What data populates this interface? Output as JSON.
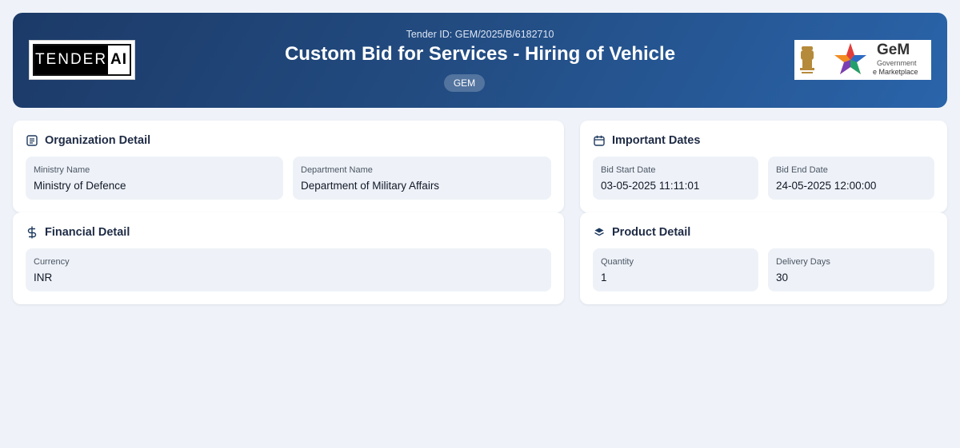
{
  "header": {
    "logo_left": {
      "word": "TENDER",
      "ai": "AI"
    },
    "tender_id": "Tender ID: GEM/2025/B/6182710",
    "title": "Custom Bid for Services - Hiring of Vehicle",
    "badge": "GEM",
    "logo_right": {
      "word": "GeM",
      "sub1": "Government",
      "sub2": "e Marketplace"
    }
  },
  "organization": {
    "title": "Organization Detail",
    "icon": "document-list-icon",
    "fields": [
      {
        "label": "Ministry Name",
        "value": "Ministry of Defence"
      },
      {
        "label": "Department Name",
        "value": "Department of Military Affairs"
      }
    ]
  },
  "dates": {
    "title": "Important Dates",
    "icon": "calendar-icon",
    "fields": [
      {
        "label": "Bid Start Date",
        "value": "03-05-2025 11:11:01"
      },
      {
        "label": "Bid End Date",
        "value": "24-05-2025 12:00:00"
      }
    ]
  },
  "financial": {
    "title": "Financial Detail",
    "icon": "dollar-icon",
    "fields": [
      {
        "label": "Currency",
        "value": "INR"
      }
    ]
  },
  "product": {
    "title": "Product Detail",
    "icon": "layers-icon",
    "fields": [
      {
        "label": "Quantity",
        "value": "1"
      },
      {
        "label": "Delivery Days",
        "value": "30"
      }
    ]
  },
  "colors": {
    "header_start": "#1c3a68",
    "header_end": "#2a64aa",
    "page_bg": "#eff3f9",
    "field_bg": "#eef2f8"
  }
}
